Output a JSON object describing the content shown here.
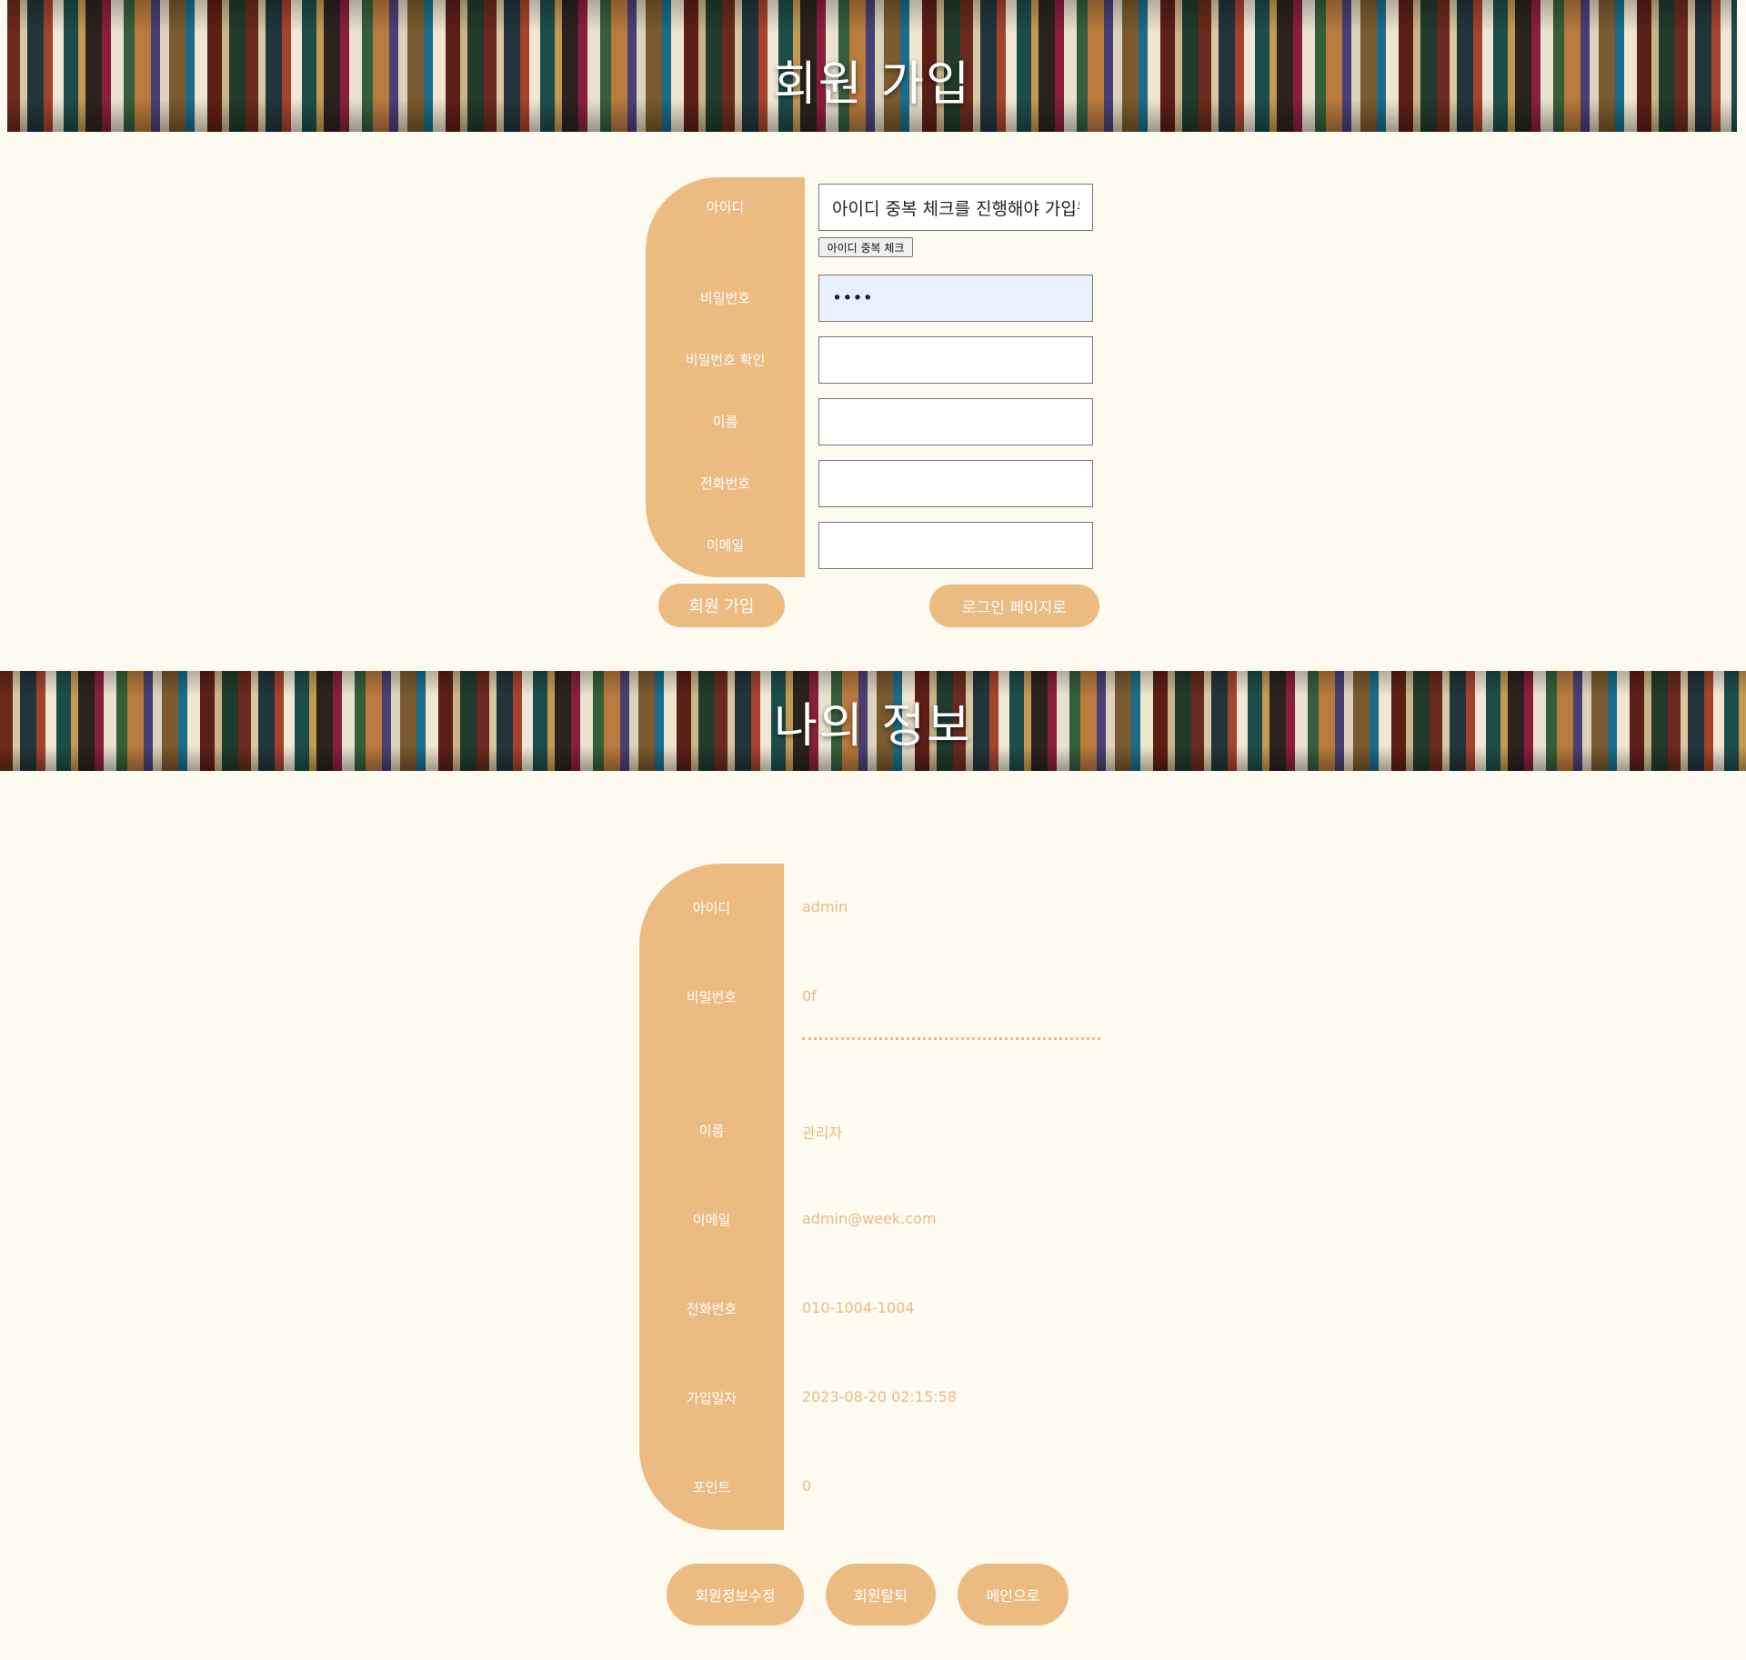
{
  "signup": {
    "title": "회원 가입",
    "labels": {
      "id": "아이디",
      "password": "비밀번호",
      "password_confirm": "비밀번호 확인",
      "name": "이름",
      "phone": "전화번호",
      "email": "이메일"
    },
    "id_value": "아이디 중복 체크를 진행해야 가입됩니다",
    "password_value": "••••",
    "password_confirm_value": "",
    "name_value": "",
    "phone_value": "",
    "email_value": "",
    "duplicate_check_label": "아이디 중복 체크",
    "submit_label": "회원 가입",
    "login_page_label": "로그인 페이지로"
  },
  "myinfo": {
    "title": "나의 정보",
    "labels": {
      "id": "아이디",
      "password": "비밀번호",
      "name": "이름",
      "email": "이메일",
      "phone": "전화번호",
      "joined": "가입일자",
      "points": "포인트"
    },
    "values": {
      "id": "admin",
      "password": "0f",
      "name": "관리자",
      "email": "admin@week.com",
      "phone": "010-1004-1004",
      "joined": "2023-08-20 02:15:58",
      "points": "0"
    },
    "buttons": {
      "edit": "회원정보수정",
      "withdraw": "회원탈퇴",
      "main": "메인으로"
    }
  },
  "colors": {
    "accent": "#ecbb82",
    "background": "#fdfaf0"
  }
}
